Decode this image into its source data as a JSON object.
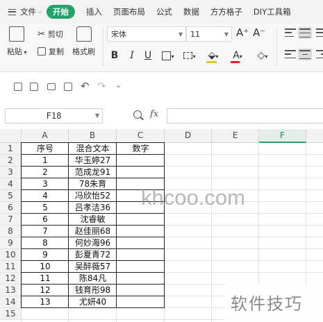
{
  "menubar": {
    "items": [
      "文件",
      "开始",
      "插入",
      "页面布局",
      "公式",
      "数据",
      "方方格子",
      "DIY工具箱"
    ],
    "active_index": 1,
    "accent_color": "#23a26b"
  },
  "ribbon": {
    "paste_label": "粘贴",
    "cut_label": "剪切",
    "copy_label": "复制",
    "format_painter_label": "格式刷",
    "font_name": "宋体",
    "font_size": "11",
    "bold": "B",
    "italic": "I",
    "underline": "U",
    "font_grow": "A⁺",
    "font_shrink": "A⁻",
    "font_color_glyph": "A"
  },
  "quick_access": {
    "icons": [
      "save-icon",
      "export-pdf-icon",
      "print-icon",
      "print-preview-icon",
      "undo-icon",
      "redo-icon",
      "more-icon"
    ]
  },
  "formula_bar": {
    "cell_ref": "F18",
    "fx_label": "fx",
    "value": ""
  },
  "sheet": {
    "columns": [
      "A",
      "B",
      "C",
      "D",
      "E",
      "F"
    ],
    "selected_column": "F",
    "row_numbers": [
      "1",
      "2",
      "3",
      "4",
      "5",
      "6",
      "7",
      "8",
      "9",
      "10",
      "11",
      "12",
      "13",
      "14",
      "15"
    ],
    "header": [
      "序号",
      "混合文本",
      "数字"
    ],
    "rows": [
      [
        "1",
        "华玉婷27",
        ""
      ],
      [
        "2",
        "范成龙91",
        ""
      ],
      [
        "3",
        "78朱育",
        ""
      ],
      [
        "4",
        "冯欣怡52",
        ""
      ],
      [
        "5",
        "吕孝洁36",
        ""
      ],
      [
        "6",
        "沈睿敏",
        ""
      ],
      [
        "7",
        "赵佳丽68",
        ""
      ],
      [
        "8",
        "何妙海96",
        ""
      ],
      [
        "9",
        "彭夏青72",
        ""
      ],
      [
        "10",
        "吴醉薇57",
        ""
      ],
      [
        "11",
        "陈84凡",
        ""
      ],
      [
        "12",
        "钱育彤98",
        ""
      ],
      [
        "13",
        "尤妍40",
        ""
      ]
    ]
  },
  "watermarks": {
    "site": "khcoo.com",
    "corner": "软件技巧"
  }
}
